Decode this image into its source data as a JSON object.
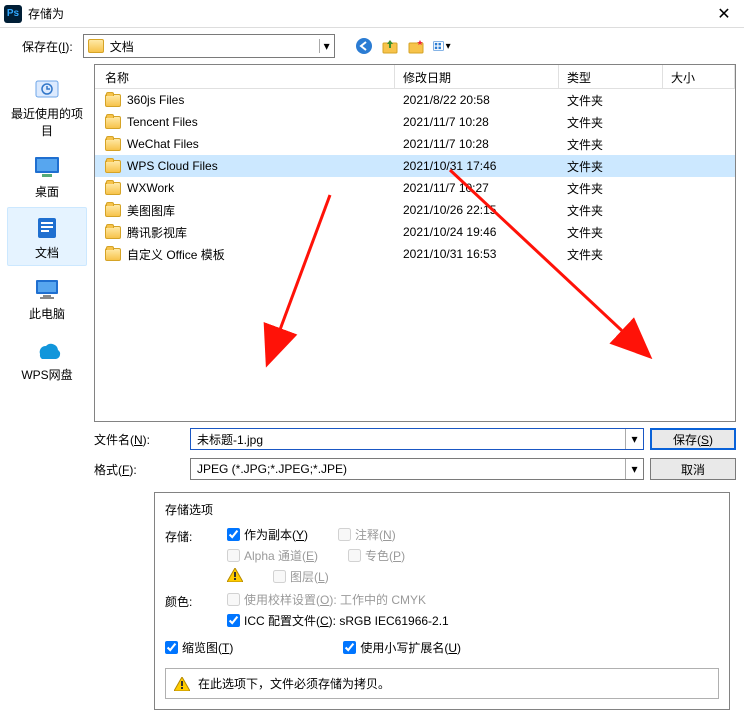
{
  "title": "存储为",
  "toolbar": {
    "saveInLabel": "保存在(I):",
    "location": "文档"
  },
  "sidebar": {
    "items": [
      {
        "label": "最近使用的项目"
      },
      {
        "label": "桌面"
      },
      {
        "label": "文档"
      },
      {
        "label": "此电脑"
      },
      {
        "label": "WPS网盘"
      }
    ]
  },
  "columns": {
    "name": "名称",
    "date": "修改日期",
    "type": "类型",
    "size": "大小"
  },
  "files": [
    {
      "name": "360js Files",
      "date": "2021/8/22 20:58",
      "type": "文件夹",
      "selected": false
    },
    {
      "name": "Tencent Files",
      "date": "2021/11/7 10:28",
      "type": "文件夹",
      "selected": false
    },
    {
      "name": "WeChat Files",
      "date": "2021/11/7 10:28",
      "type": "文件夹",
      "selected": false
    },
    {
      "name": "WPS Cloud Files",
      "date": "2021/10/31 17:46",
      "type": "文件夹",
      "selected": true
    },
    {
      "name": "WXWork",
      "date": "2021/11/7 10:27",
      "type": "文件夹",
      "selected": false
    },
    {
      "name": "美图图库",
      "date": "2021/10/26 22:15",
      "type": "文件夹",
      "selected": false
    },
    {
      "name": "腾讯影视库",
      "date": "2021/10/24 19:46",
      "type": "文件夹",
      "selected": false
    },
    {
      "name": "自定义 Office 模板",
      "date": "2021/10/31 16:53",
      "type": "文件夹",
      "selected": false
    }
  ],
  "form": {
    "filenameLabel": "文件名(N):",
    "filename": "未标题-1.jpg",
    "formatLabel": "格式(F):",
    "format": "JPEG (*.JPG;*.JPEG;*.JPE)",
    "saveBtn": "保存(S)",
    "cancelBtn": "取消"
  },
  "options": {
    "header": "存储选项",
    "storeLabel": "存储:",
    "colorLabel": "颜色:",
    "asCopy": "作为副本(Y)",
    "notes": "注释(N)",
    "alpha": "Alpha 通道(E)",
    "spot": "专色(P)",
    "layers": "图层(L)",
    "proof": "使用校样设置(O): 工作中的 CMYK",
    "icc": "ICC 配置文件(C): sRGB IEC61966-2.1",
    "thumb": "缩览图(T)",
    "lowercase": "使用小写扩展名(U)",
    "alert": "在此选项下，文件必须存储为拷贝。"
  }
}
